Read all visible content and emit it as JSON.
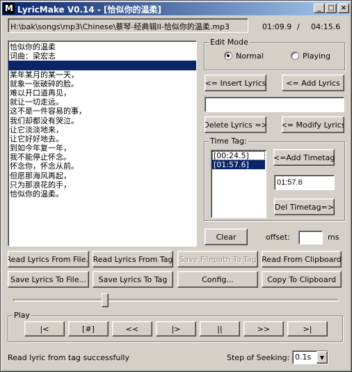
{
  "window": {
    "title": "LyricMake V0.14 - [恰似你的温柔]",
    "icon_letter": "M",
    "minimize_glyph": "_",
    "maximize_glyph": "□",
    "close_glyph": "×"
  },
  "file": {
    "path": "H:\\bak\\songs\\mp3\\Chinese\\蔡琴-经典辑II-恰似你的温柔.mp3",
    "current_time": "01:09.9",
    "separator": "/",
    "total_time": "04:15.6"
  },
  "lyrics": {
    "lines": [
      "恰似你的温柔",
      "词曲：梁宏志",
      "",
      "某年某月的某一天，",
      "就象一张破碎的脸。",
      "难以开口道再见，",
      "就让一切走远。",
      "这不是一件容易的事，",
      "我们却都没有哭泣。",
      "让它淡淡地来，",
      "让它好好地去。",
      "到如今年复一年，",
      "我不能停止怀念。",
      "怀念你，怀念从前。",
      "但愿那海风再起，",
      "只为那浪花的手，",
      "恰似你的温柔。"
    ],
    "selected_index": 2
  },
  "edit_mode": {
    "label": "Edit Mode",
    "normal_label": "Normal",
    "playing_label": "Playing",
    "selected": "normal"
  },
  "buttons": {
    "insert_lyrics": "<= Insert Lyrics",
    "add_lyrics": "<= Add Lyrics",
    "delete_lyrics": "Delete Lyrics =>",
    "modify_lyrics": "<= Modify Lyrics",
    "add_timetag": "<=Add Timetag",
    "del_timetag": "Del Timetag=>",
    "clear": "Clear",
    "read_from_file": "Read Lyrics From File..",
    "read_from_tag": "Read Lyrics From Tag",
    "save_filepath_to_tag": "Save Filepath To Tag",
    "read_from_clipboard": "Read From Clipboard",
    "save_to_file": "Save Lyrics To File...",
    "save_to_tag": "Save Lyrics To Tag",
    "config": "Config...",
    "copy_to_clipboard": "Copy To Clipboard"
  },
  "lyric_input": {
    "value": ""
  },
  "time_tag": {
    "label": "Time Tag:",
    "items": [
      "[00:24.5]",
      "[01:57.6]"
    ],
    "selected_index": 1,
    "value": "01:57.6"
  },
  "offset": {
    "label": "offset:",
    "value": "",
    "unit": "ms"
  },
  "seek": {
    "position": 0.282
  },
  "play": {
    "label": "Play",
    "controls": [
      "|<",
      "[#]",
      "<<",
      "|>",
      "||",
      ">>",
      ">|"
    ]
  },
  "status": {
    "message": "Read lyric from tag successfully",
    "step_label": "Step of Seeking:",
    "step_value": "0.1s",
    "dropdown_glyph": "▼"
  }
}
